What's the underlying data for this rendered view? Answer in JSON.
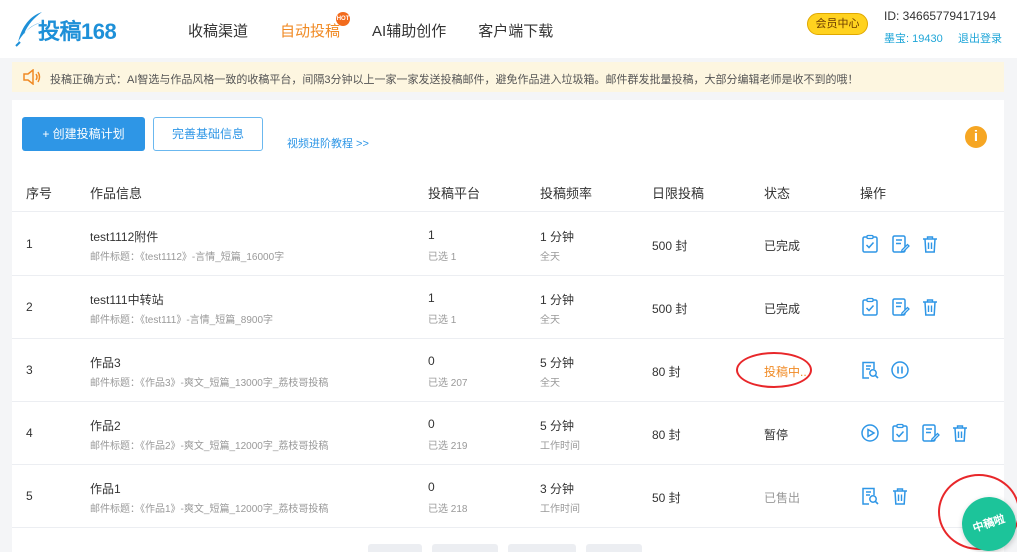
{
  "header": {
    "logo_text": "投稿168",
    "nav": [
      {
        "label": "收稿渠道",
        "active": false
      },
      {
        "label": "自动投稿",
        "active": true,
        "badge": "HOT"
      },
      {
        "label": "AI辅助创作",
        "active": false
      },
      {
        "label": "客户端下载",
        "active": false
      }
    ],
    "vip_label": "会员中心",
    "user_id": "ID: 34665779417194",
    "coins": "墨宝: 19430",
    "logout": "退出登录"
  },
  "notice": {
    "text": "投稿正确方式：AI智选与作品风格一致的收稿平台，间隔3分钟以上一家一家发送投稿邮件，避免作品进入垃圾箱。邮件群发批量投稿，大部分编辑老师是收不到的哦！"
  },
  "toolbar": {
    "create_label": "+ 创建投稿计划",
    "complete_label": "完善基础信息",
    "video_link": "视频进阶教程 >>",
    "info_icon": "i"
  },
  "table": {
    "headers": [
      "序号",
      "作品信息",
      "投稿平台",
      "投稿频率",
      "日限投稿",
      "状态",
      "操作"
    ],
    "rows": [
      {
        "index": "1",
        "title": "test1112附件",
        "subject": "邮件标题：《test1112》-言情_短篇_16000字",
        "platforms": "1",
        "selected": "已选 1",
        "freq": "1 分钟",
        "freq_sub": "全天",
        "daily": "500 封",
        "status": "已完成",
        "status_type": "done",
        "ops": [
          "check-icon",
          "edit-icon",
          "delete-icon"
        ]
      },
      {
        "index": "2",
        "title": "test111中转站",
        "subject": "邮件标题：《test111》-言情_短篇_8900字",
        "platforms": "1",
        "selected": "已选 1",
        "freq": "1 分钟",
        "freq_sub": "全天",
        "daily": "500 封",
        "status": "已完成",
        "status_type": "done",
        "ops": [
          "check-icon",
          "edit-icon",
          "delete-icon"
        ]
      },
      {
        "index": "3",
        "title": "作品3",
        "subject": "邮件标题：《作品3》-爽文_短篇_13000字_荔枝哥投稿",
        "platforms": "0",
        "selected": "已选 207",
        "freq": "5 分钟",
        "freq_sub": "全天",
        "daily": "80 封",
        "status": "投稿中..",
        "status_type": "running",
        "ops": [
          "search-doc-icon",
          "pause-icon"
        ]
      },
      {
        "index": "4",
        "title": "作品2",
        "subject": "邮件标题：《作品2》-爽文_短篇_12000字_荔枝哥投稿",
        "platforms": "0",
        "selected": "已选 219",
        "freq": "5 分钟",
        "freq_sub": "工作时间",
        "daily": "80 封",
        "status": "暂停",
        "status_type": "paused",
        "ops": [
          "play-icon",
          "check-icon",
          "edit-icon",
          "delete-icon"
        ]
      },
      {
        "index": "5",
        "title": "作品1",
        "subject": "邮件标题：《作品1》-爽文_短篇_12000字_荔枝哥投稿",
        "platforms": "0",
        "selected": "已选 218",
        "freq": "3 分钟",
        "freq_sub": "工作时间",
        "daily": "50 封",
        "status": "已售出",
        "status_type": "sold",
        "ops": [
          "search-doc-icon",
          "delete-icon"
        ]
      }
    ]
  },
  "float_button": "中稿啦",
  "colors": {
    "accent": "#2e96e6",
    "orange": "#f08a24",
    "green": "#1cc49a",
    "red": "#e8272a"
  }
}
